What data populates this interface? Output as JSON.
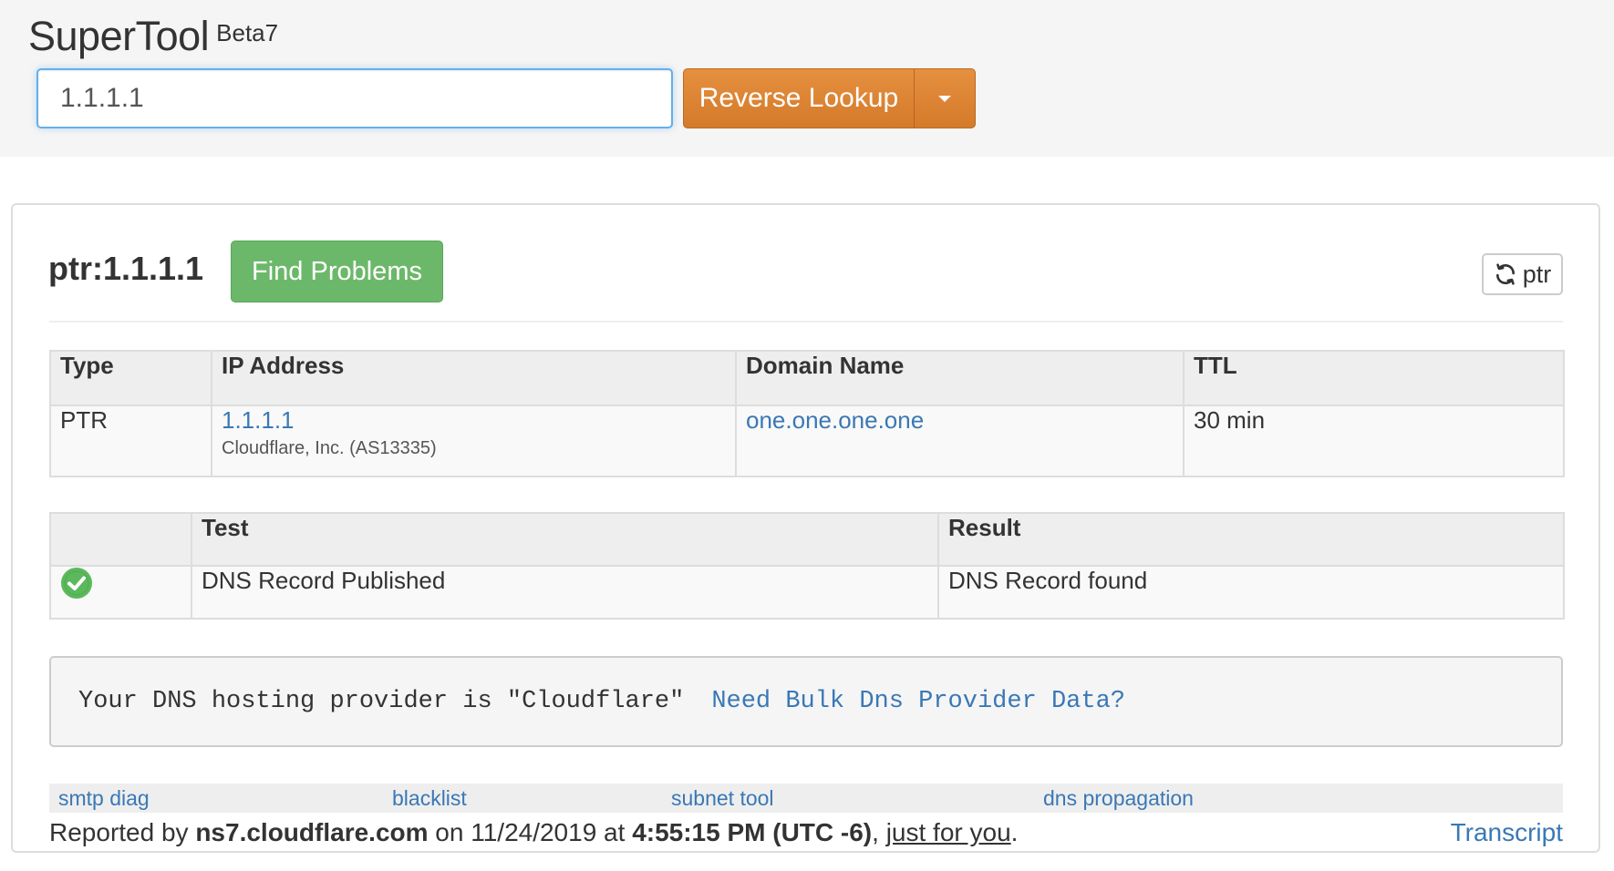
{
  "brand": {
    "name": "SuperTool",
    "badge": "Beta7"
  },
  "search": {
    "value": "1.1.1.1",
    "button_label": "Reverse Lookup"
  },
  "panel": {
    "title": "ptr:1.1.1.1",
    "find_problems_label": "Find Problems",
    "refresh_label": "ptr"
  },
  "records_table": {
    "headers": [
      "Type",
      "IP Address",
      "Domain Name",
      "TTL"
    ],
    "rows": [
      {
        "type": "PTR",
        "ip": "1.1.1.1",
        "ip_owner": "Cloudflare, Inc. (AS13335)",
        "domain": "one.one.one.one",
        "ttl": "30 min"
      }
    ]
  },
  "tests_table": {
    "headers": [
      "",
      "Test",
      "Result"
    ],
    "rows": [
      {
        "status_icon": "check-circle-icon",
        "test": "DNS Record Published",
        "result": "DNS Record found"
      }
    ]
  },
  "provider": {
    "text": "Your DNS hosting provider is \"Cloudflare\"",
    "link": "Need Bulk Dns Provider Data?"
  },
  "tools": [
    "smtp diag",
    "blacklist",
    "subnet tool",
    "dns propagation"
  ],
  "footer": {
    "prefix": "Reported by ",
    "server": "ns7.cloudflare.com",
    "on": " on 11/24/2019 at ",
    "time": "4:55:15 PM (UTC -6)",
    "comma": ", ",
    "personal": "just for you",
    "end": ".",
    "transcript": "Transcript"
  },
  "colors": {
    "accent_orange": "#d47a2b",
    "success_green": "#6cb86a",
    "link_blue": "#3a78b5"
  }
}
